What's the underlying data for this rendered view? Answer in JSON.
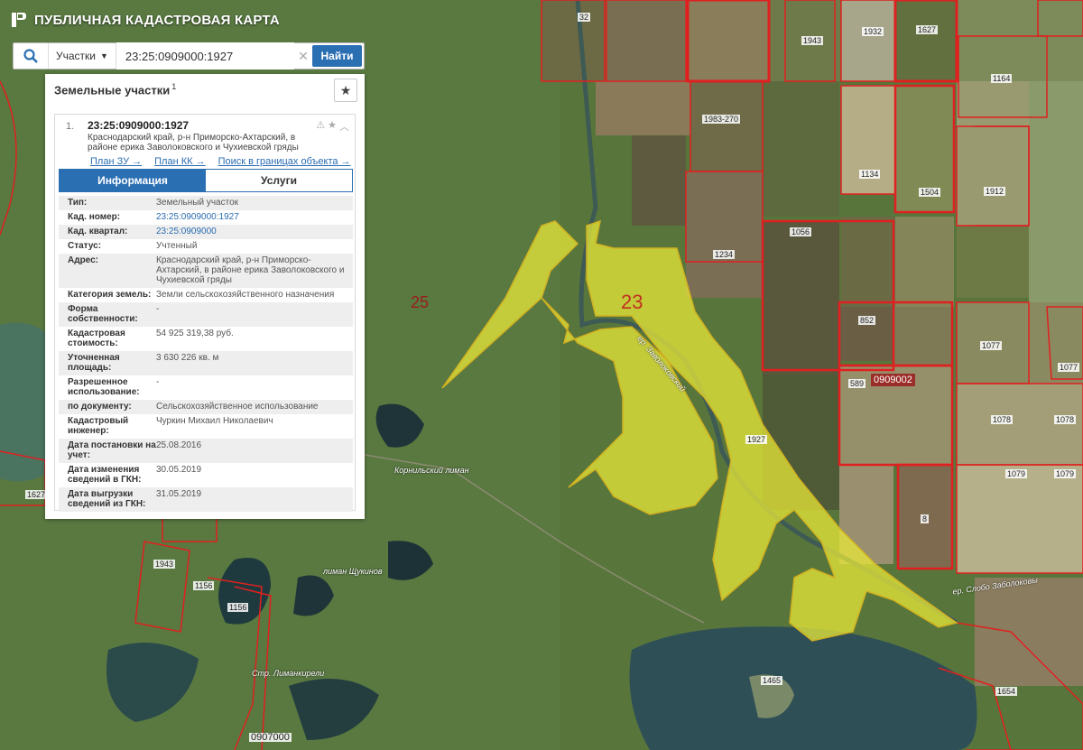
{
  "header": {
    "title": "ПУБЛИЧНАЯ КАДАСТРОВАЯ КАРТА"
  },
  "search": {
    "type_label": "Участки",
    "value": "23:25:0909000:1927",
    "button_label": "Найти"
  },
  "panel": {
    "title": "Земельные участки",
    "count": "1",
    "result": {
      "index": "1.",
      "cad_number": "23:25:0909000:1927",
      "address_short": "Краснодарский край, р-н Приморско-Ахтарский, в районе ерика Заволоковского и Чухиевской гряды",
      "links": [
        "План ЗУ →",
        "План КК →",
        "Поиск в границах объекта →"
      ]
    },
    "tabs": {
      "info": "Информация",
      "services": "Услуги"
    },
    "properties": [
      {
        "label": "Тип:",
        "value": "Земельный участок"
      },
      {
        "label": "Кад. номер:",
        "value": "23:25:0909000:1927",
        "link": true
      },
      {
        "label": "Кад. квартал:",
        "value": "23:25:0909000",
        "link": true
      },
      {
        "label": "Статус:",
        "value": "Учтенный"
      },
      {
        "label": "Адрес:",
        "value": "Краснодарский край, р-н Приморско-Ахтарский, в районе ерика Заволоковского и Чухиевской гряды"
      },
      {
        "label": "Категория земель:",
        "value": "Земли сельскохозяйственного назначения"
      },
      {
        "label": "Форма собственности:",
        "value": "-"
      },
      {
        "label": "Кадастровая стоимость:",
        "value": "54 925 319,38 руб."
      },
      {
        "label": "Уточненная площадь:",
        "value": "3 630 226 кв. м"
      },
      {
        "label": "Разрешенное использование:",
        "value": "-"
      },
      {
        "label": "по документу:",
        "value": "Сельскохозяйственное использование"
      },
      {
        "label": "Кадастровый инженер:",
        "value": "Чуркин Михаил Николаевич"
      },
      {
        "label": "Дата постановки на учет:",
        "value": "25.08.2016"
      },
      {
        "label": "Дата изменения сведений в ГКН:",
        "value": "30.05.2019"
      },
      {
        "label": "Дата выгрузки сведений из ГКН:",
        "value": "31.05.2019"
      }
    ]
  },
  "map": {
    "zone_labels": [
      "25",
      "23"
    ],
    "quarter_label": "0909002",
    "parcel_labels": [
      "32",
      "1943",
      "1932",
      "1627",
      "1164",
      "1983-270",
      "1134",
      "1504",
      "1912",
      "1056",
      "1234",
      "852",
      "1077",
      "1077",
      "589",
      "1078",
      "1078",
      "1079",
      "1079",
      "1927",
      "8",
      "1627",
      "1943",
      "1156",
      "1156",
      "1465",
      "1654",
      "0907000"
    ],
    "place_names": [
      "Корнильский лиман",
      "лиман Щукинов",
      "Стр. Лиманкирели",
      "ер. Заволоковский",
      "ер. Слобо Заболоковы"
    ]
  },
  "colors": {
    "accent": "#2b6fb3",
    "boundary": "#e02020",
    "selection": "#e8e83a"
  }
}
